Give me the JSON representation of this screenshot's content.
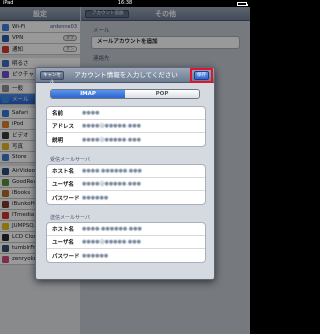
{
  "status": {
    "carrier": "iPad",
    "time": "16:38"
  },
  "master": {
    "title": "設定",
    "items": [
      {
        "label": "Wi-Fi",
        "value": "ardenne03",
        "icon_color": "#3f7fe0"
      },
      {
        "label": "VPN",
        "toggle": "オフ",
        "icon_color": "#2d5ca8"
      },
      {
        "label": "通知",
        "toggle": "オン",
        "icon_color": "#d43a2f"
      },
      {
        "label": "明るさ",
        "icon_color": "#3f6fc4"
      },
      {
        "label": "ピクチャ",
        "icon_color": "#6c4fd0"
      },
      {
        "label": "一般",
        "icon_color": "#8a8f99"
      },
      {
        "label": "メール",
        "icon_color": "#3b8ee6",
        "selected": true
      },
      {
        "label": "Safari",
        "icon_color": "#2f7bd8"
      },
      {
        "label": "iPod",
        "icon_color": "#e0812e"
      },
      {
        "label": "ビデオ",
        "icon_color": "#3b3b3b"
      },
      {
        "label": "写真",
        "icon_color": "#e8b620"
      },
      {
        "label": "Store",
        "icon_color": "#3b7fd1"
      },
      {
        "label": "AirVideo",
        "icon_color": "#2e4d7a"
      },
      {
        "label": "GoodReader",
        "icon_color": "#5a8f3a"
      },
      {
        "label": "iBooks",
        "icon_color": "#b46a23"
      },
      {
        "label": "iBunkoHD",
        "icon_color": "#7a3a2a"
      },
      {
        "label": "ITmedia",
        "icon_color": "#d0322b"
      },
      {
        "label": "JUMPSQ.HD",
        "icon_color": "#e6c21e"
      },
      {
        "label": "LCD Clock HD",
        "icon_color": "#2b2b2b"
      },
      {
        "label": "tumblrFrame",
        "icon_color": "#34506e"
      },
      {
        "label": "zenryoku",
        "icon_color": "#d04a7a"
      }
    ]
  },
  "detail": {
    "back_label": "アカウント追加",
    "title": "その他",
    "section_mail": "メール",
    "add_mail": "メールアカウントを追加",
    "section_contacts": "連絡先"
  },
  "sheet": {
    "cancel_label": "キャンセル",
    "title": "アカウント情報を入力してください",
    "save_label": "保存",
    "tabs": [
      "IMAP",
      "POP"
    ],
    "account": [
      {
        "label": "名前",
        "value": "●●●●"
      },
      {
        "label": "アドレス",
        "value": "●●●●@●●●●●.●●●"
      },
      {
        "label": "説明",
        "value": "●●●●@●●●●●.●●●"
      }
    ],
    "incoming_title": "受信メールサーバ",
    "incoming": [
      {
        "label": "ホスト名",
        "value": "●●●●.●●●●●●.●●●"
      },
      {
        "label": "ユーザ名",
        "value": "●●●●@●●●●●.●●●"
      },
      {
        "label": "パスワード",
        "value": "●●●●●●"
      }
    ],
    "outgoing_title": "送信メールサーバ",
    "outgoing": [
      {
        "label": "ホスト名",
        "value": "●●●●.●●●●●●.●●●"
      },
      {
        "label": "ユーザ名",
        "value": "●●●●@●●●●●.●●●"
      },
      {
        "label": "パスワード",
        "value": "●●●●●●"
      }
    ]
  },
  "colors": {
    "accent": "#2f64d2",
    "highlight": "#e0142d"
  }
}
